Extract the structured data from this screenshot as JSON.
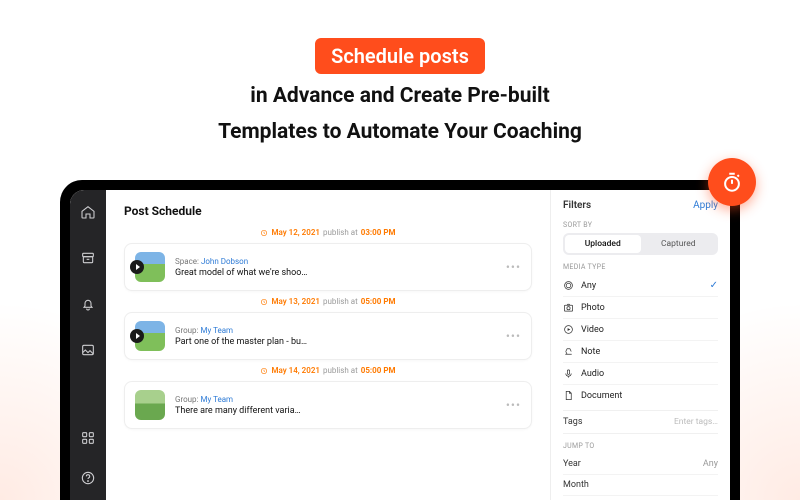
{
  "hero": {
    "pill": "Schedule posts",
    "line1": "in Advance and Create Pre-built",
    "line2": "Templates to Automate Your Coaching"
  },
  "feed": {
    "title": "Post Schedule",
    "dates": [
      {
        "date": "May 12, 2021",
        "publish_label": "publish at",
        "time": "03:00 PM"
      },
      {
        "date": "May 13, 2021",
        "publish_label": "publish at",
        "time": "05:00 PM"
      },
      {
        "date": "May 14, 2021",
        "publish_label": "publish at",
        "time": "05:00 PM"
      }
    ],
    "posts": [
      {
        "scope_label": "Space:",
        "scope_name": "John Dobson",
        "text": "Great model of what we're shoo…"
      },
      {
        "scope_label": "Group:",
        "scope_name": "My Team",
        "text": "Part one of the master plan - bu…"
      },
      {
        "scope_label": "Group:",
        "scope_name": "My Team",
        "text": "There are many different varia…"
      }
    ]
  },
  "filters": {
    "title": "Filters",
    "apply_label": "Apply",
    "sort_by_label": "Sort By",
    "sort_options": [
      "Uploaded",
      "Captured"
    ],
    "sort_active": "Uploaded",
    "media_label": "Media Type",
    "media_types": [
      "Any",
      "Photo",
      "Video",
      "Note",
      "Audio",
      "Document"
    ],
    "media_selected": "Any",
    "tags_label": "Tags",
    "tags_placeholder": "Enter tags…",
    "jump_to_label": "Jump To",
    "jump_year_label": "Year",
    "jump_year_value": "Any",
    "jump_month_label": "Month"
  }
}
